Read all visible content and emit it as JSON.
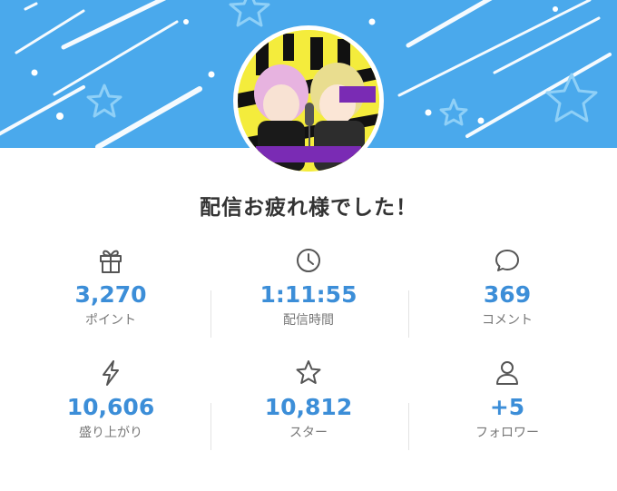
{
  "title": "配信お疲れ様でした！",
  "accent_color": "#3c8ed8",
  "banner_color": "#4aa9ec",
  "stats": [
    {
      "icon": "gift-icon",
      "value": "3,270",
      "label": "ポイント"
    },
    {
      "icon": "clock-icon",
      "value": "1:11:55",
      "label": "配信時間"
    },
    {
      "icon": "comment-icon",
      "value": "369",
      "label": "コメント"
    },
    {
      "icon": "lightning-icon",
      "value": "10,606",
      "label": "盛り上がり"
    },
    {
      "icon": "star-icon",
      "value": "10,812",
      "label": "スター"
    },
    {
      "icon": "user-icon",
      "value": "+5",
      "label": "フォロワー"
    }
  ]
}
